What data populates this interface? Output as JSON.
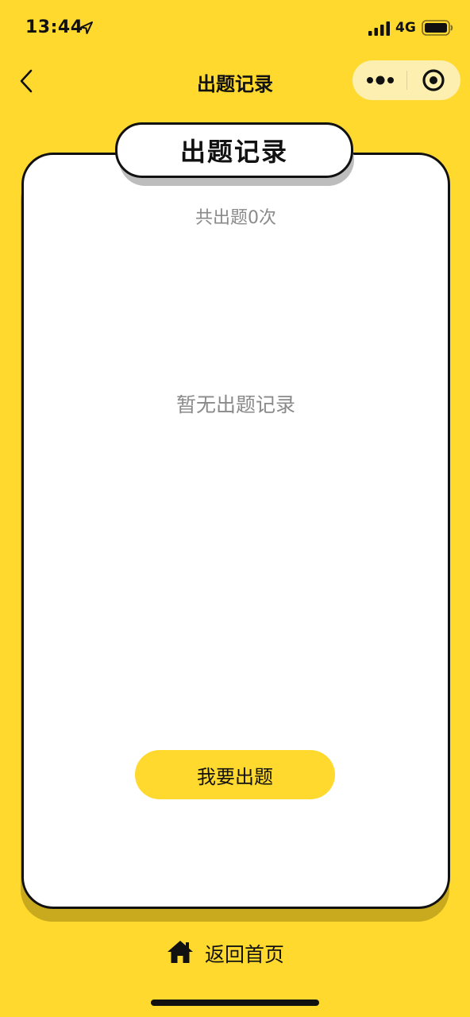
{
  "status_bar": {
    "time": "13:44",
    "network": "4G"
  },
  "nav": {
    "title": "出题记录"
  },
  "card": {
    "header": "出题记录",
    "count_text": "共出题0次",
    "empty_text": "暂无出题记录",
    "create_button": "我要出题"
  },
  "footer": {
    "home_label": "返回首页"
  },
  "colors": {
    "background": "#FFD92E",
    "card": "#FFFFFF",
    "text_muted": "#8A8A8A",
    "outline": "#111111"
  },
  "icons": [
    "location-arrow-icon",
    "signal-icon",
    "battery-icon",
    "chevron-left-icon",
    "more-dots-icon",
    "target-circle-icon",
    "home-icon"
  ]
}
